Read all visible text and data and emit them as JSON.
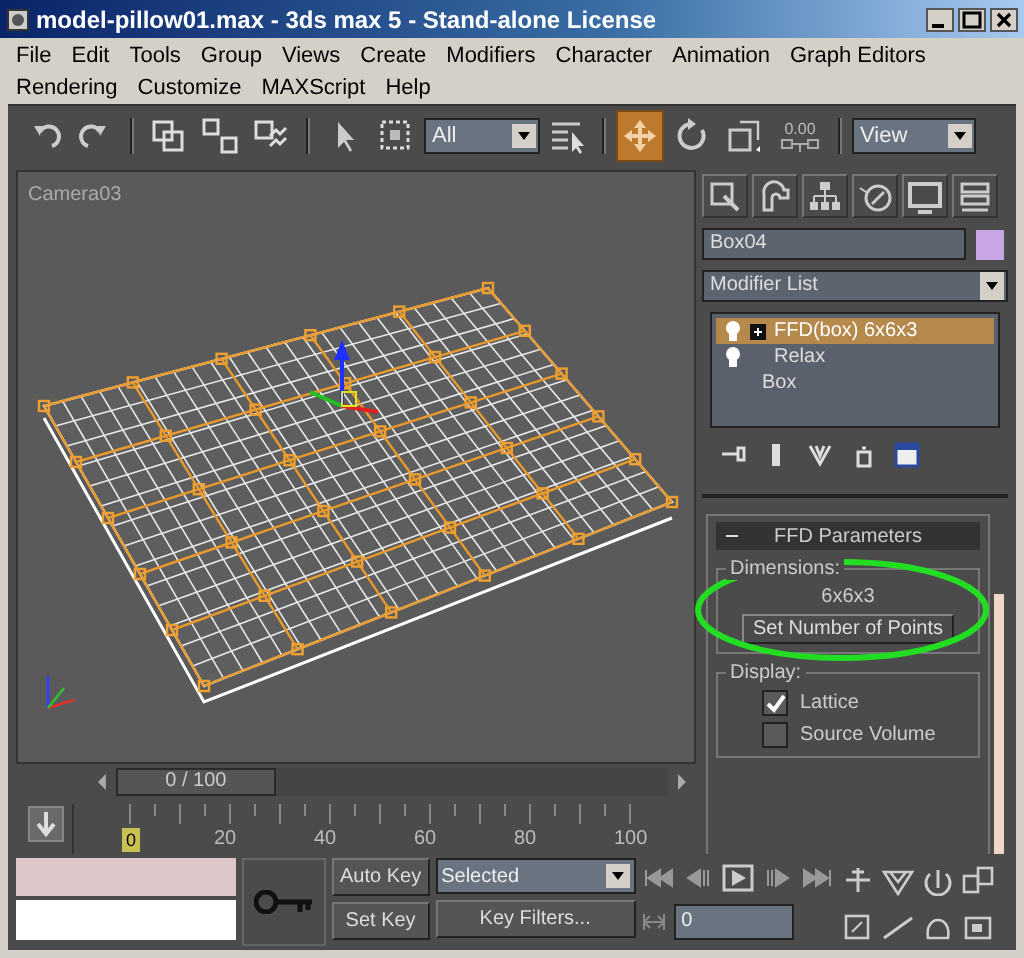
{
  "window": {
    "title": "model-pillow01.max - 3ds max 5 - Stand-alone License"
  },
  "menu": [
    "File",
    "Edit",
    "Tools",
    "Group",
    "Views",
    "Create",
    "Modifiers",
    "Character",
    "Animation",
    "Graph Editors",
    "Rendering",
    "Customize",
    "MAXScript",
    "Help"
  ],
  "toolbar": {
    "tools": [
      {
        "kind": "undo",
        "selected": false
      },
      {
        "kind": "redo",
        "selected": false
      },
      {
        "kind": "sep"
      },
      {
        "kind": "link",
        "selected": false
      },
      {
        "kind": "unlink",
        "selected": false
      },
      {
        "kind": "bind",
        "selected": false
      },
      {
        "kind": "sep"
      },
      {
        "kind": "select",
        "selected": false
      },
      {
        "kind": "region",
        "selected": false
      },
      {
        "kind": "filter",
        "value": "All"
      },
      {
        "kind": "byname",
        "selected": false
      },
      {
        "kind": "sep"
      },
      {
        "kind": "move",
        "selected": true
      },
      {
        "kind": "rotate",
        "selected": false
      },
      {
        "kind": "scale",
        "selected": false
      },
      {
        "kind": "spinner",
        "value": "0.00"
      },
      {
        "kind": "sep"
      },
      {
        "kind": "coord",
        "value": "View"
      }
    ]
  },
  "viewport": {
    "label": "Camera03"
  },
  "command_panel": {
    "object_name": "Box04",
    "modifier_list": "Modifier List",
    "stack": [
      {
        "label": "FFD(box) 6x6x3",
        "kind": "modifier",
        "selected": true,
        "expander": true
      },
      {
        "label": "Relax",
        "kind": "modifier",
        "selected": false,
        "expander": false
      },
      {
        "label": "Box",
        "kind": "base",
        "selected": false,
        "expander": false
      }
    ],
    "rollout": {
      "title": "FFD Parameters",
      "expanded": true,
      "dimensions": {
        "label": "Dimensions:",
        "value": "6x6x3",
        "button": "Set Number of Points"
      },
      "display": {
        "label": "Display:",
        "options": [
          {
            "label": "Lattice",
            "checked": true
          },
          {
            "label": "Source Volume",
            "checked": false
          }
        ]
      }
    }
  },
  "timeline": {
    "frame_display": "0 / 100",
    "level": 0,
    "ticks": [
      "0",
      "20",
      "40",
      "60",
      "80",
      "100"
    ]
  },
  "controls": {
    "auto_key": "Auto Key",
    "set_key": "Set Key",
    "key_mode": "Selected",
    "key_filters": "Key Filters...",
    "current_frame": "0"
  }
}
